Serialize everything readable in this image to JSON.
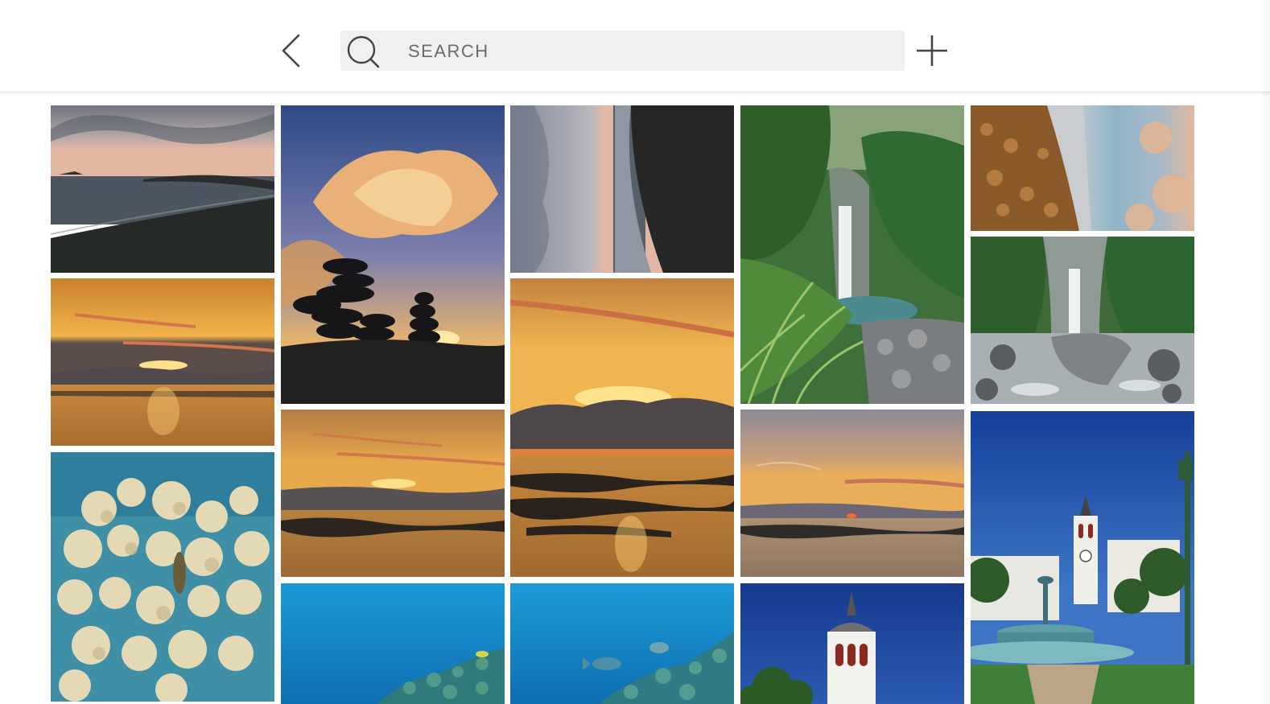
{
  "toolbar": {
    "back_icon": "chevron-left-icon",
    "search": {
      "icon": "search-icon",
      "placeholder": "SEARCH",
      "value": ""
    },
    "add_icon": "plus-icon"
  },
  "photos": [
    {
      "subject": "coast-dusk"
    },
    {
      "subject": "stacked-stones-sunset"
    },
    {
      "subject": "rotated-cliff-sea"
    },
    {
      "subject": "jungle-waterfall"
    },
    {
      "subject": "rotated-rocky-shore"
    },
    {
      "subject": "sunset-sea-wide"
    },
    {
      "subject": "waterfall-rocks"
    },
    {
      "subject": "sunset-sea-tall"
    },
    {
      "subject": "sunset-reef"
    },
    {
      "subject": "sunset-horizon"
    },
    {
      "subject": "coral-reef"
    },
    {
      "subject": "town-square-church-fountain"
    },
    {
      "subject": "underwater-reef"
    },
    {
      "subject": "underwater-fish"
    },
    {
      "subject": "church-bell-tower"
    }
  ],
  "colors": {
    "toolbar_bg": "#ffffff",
    "search_bg": "#f0f0f0",
    "icon_stroke": "#444444"
  }
}
